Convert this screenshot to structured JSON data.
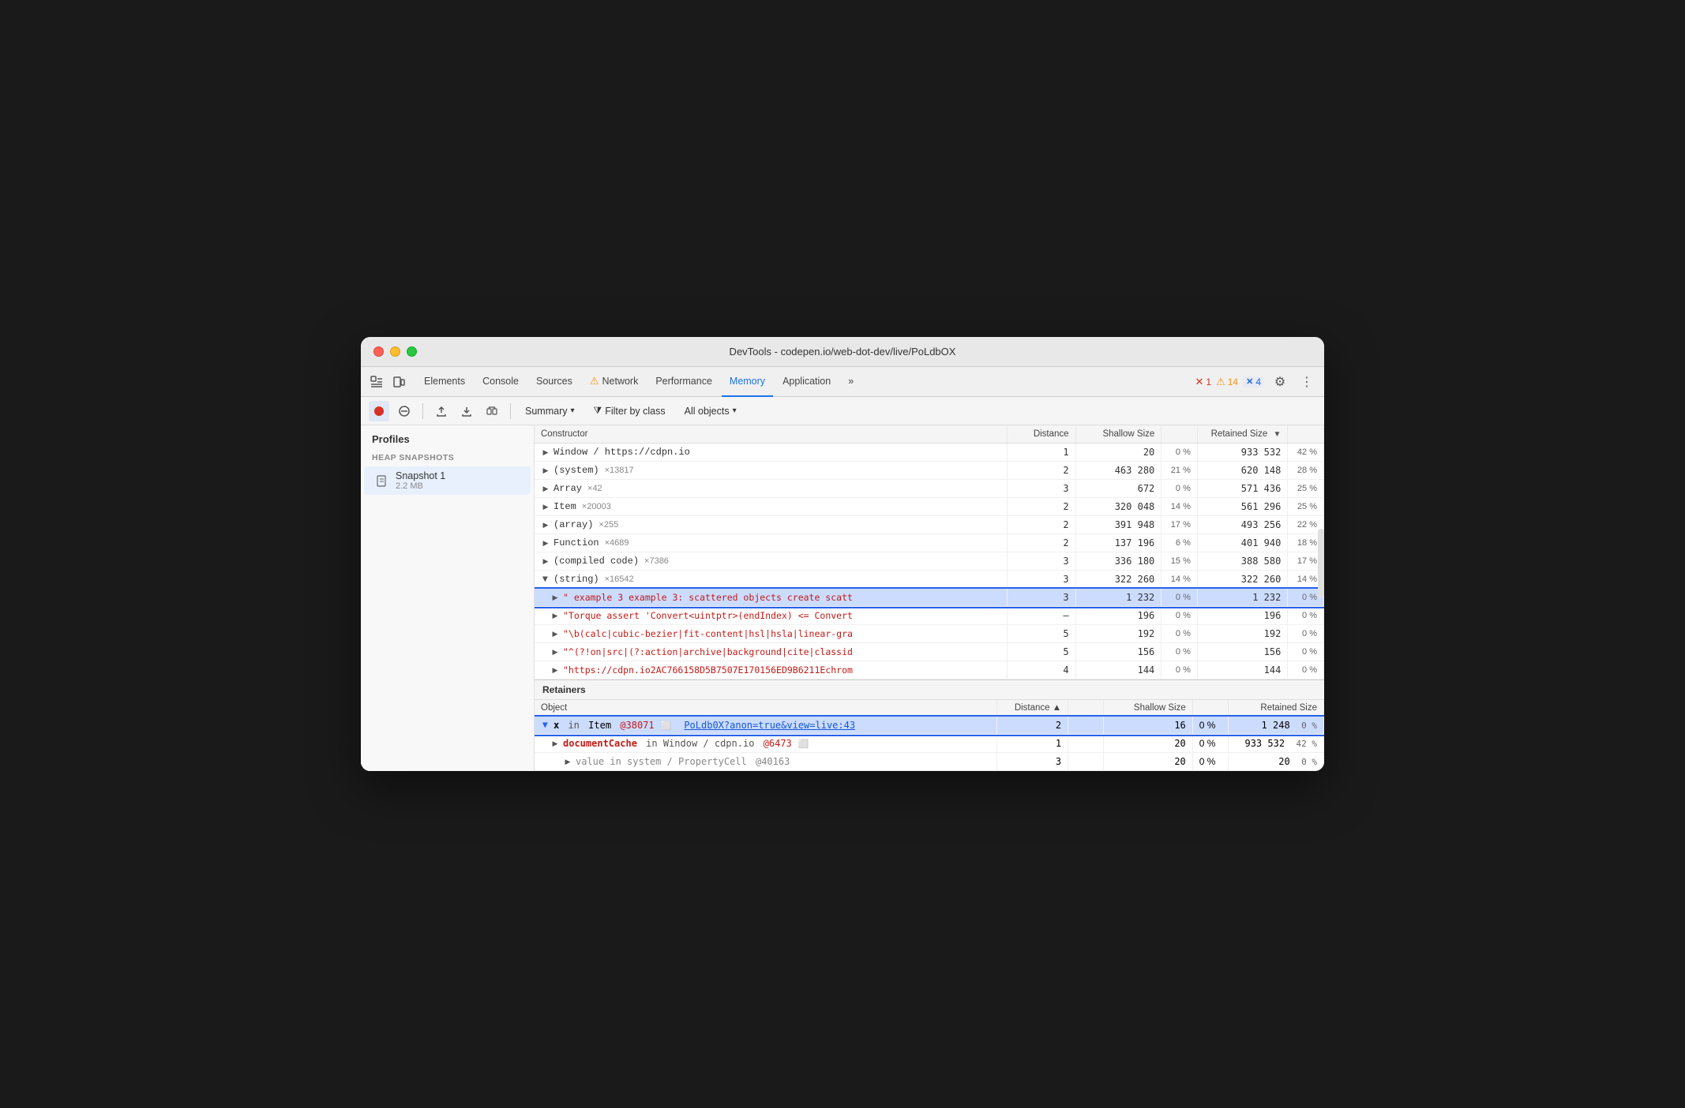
{
  "window": {
    "title": "DevTools - codepen.io/web-dot-dev/live/PoLdbOX"
  },
  "tabs": {
    "items": [
      {
        "label": "Elements",
        "active": false
      },
      {
        "label": "Console",
        "active": false
      },
      {
        "label": "Sources",
        "active": false
      },
      {
        "label": "⚠ Network",
        "active": false
      },
      {
        "label": "Performance",
        "active": false
      },
      {
        "label": "Memory",
        "active": true
      },
      {
        "label": "Application",
        "active": false
      },
      {
        "label": "»",
        "active": false
      }
    ],
    "errors": {
      "icon": "✕",
      "count": "1"
    },
    "warnings": {
      "icon": "⚠",
      "count": "14"
    },
    "info": {
      "icon": "✕",
      "count": "4"
    }
  },
  "toolbar": {
    "summary_label": "Summary",
    "filter_label": "Filter by class",
    "objects_label": "All objects"
  },
  "sidebar": {
    "title": "Profiles",
    "section_label": "HEAP SNAPSHOTS",
    "snapshot": {
      "name": "Snapshot 1",
      "size": "2.2 MB"
    }
  },
  "table": {
    "columns": [
      "Constructor",
      "Distance",
      "Shallow Size",
      "",
      "Retained Size",
      ""
    ],
    "rows": [
      {
        "constructor": "Window / https://cdpn.io",
        "indent": 0,
        "expandable": true,
        "distance": "1",
        "shallow": "20",
        "shallow_pct": "0 %",
        "retained": "933 532",
        "retained_pct": "42 %"
      },
      {
        "constructor": "(system)",
        "count": "×13817",
        "indent": 0,
        "expandable": true,
        "distance": "2",
        "shallow": "463 280",
        "shallow_pct": "21 %",
        "retained": "620 148",
        "retained_pct": "28 %"
      },
      {
        "constructor": "Array",
        "count": "×42",
        "indent": 0,
        "expandable": true,
        "distance": "3",
        "shallow": "672",
        "shallow_pct": "0 %",
        "retained": "571 436",
        "retained_pct": "25 %"
      },
      {
        "constructor": "Item",
        "count": "×20003",
        "indent": 0,
        "expandable": true,
        "distance": "2",
        "shallow": "320 048",
        "shallow_pct": "14 %",
        "retained": "561 296",
        "retained_pct": "25 %"
      },
      {
        "constructor": "(array)",
        "count": "×255",
        "indent": 0,
        "expandable": true,
        "distance": "2",
        "shallow": "391 948",
        "shallow_pct": "17 %",
        "retained": "493 256",
        "retained_pct": "22 %"
      },
      {
        "constructor": "Function",
        "count": "×4689",
        "indent": 0,
        "expandable": true,
        "distance": "2",
        "shallow": "137 196",
        "shallow_pct": "6 %",
        "retained": "401 940",
        "retained_pct": "18 %"
      },
      {
        "constructor": "(compiled code)",
        "count": "×7386",
        "indent": 0,
        "expandable": true,
        "distance": "3",
        "shallow": "336 180",
        "shallow_pct": "15 %",
        "retained": "388 580",
        "retained_pct": "17 %"
      },
      {
        "constructor": "(string)",
        "count": "×16542",
        "indent": 0,
        "expandable": true,
        "open": true,
        "distance": "3",
        "shallow": "322 260",
        "shallow_pct": "14 %",
        "retained": "322 260",
        "retained_pct": "14 %"
      },
      {
        "constructor": "\" example 3 example 3: scattered objects create scatt",
        "indent": 1,
        "expandable": true,
        "is_string": true,
        "selected": true,
        "distance": "3",
        "shallow": "1 232",
        "shallow_pct": "0 %",
        "retained": "1 232",
        "retained_pct": "0 %"
      },
      {
        "constructor": "\"Torque assert 'Convert<uintptr>(endIndex) <= Convert",
        "indent": 1,
        "expandable": true,
        "is_string": true,
        "is_red": true,
        "distance": "–",
        "shallow": "196",
        "shallow_pct": "0 %",
        "retained": "196",
        "retained_pct": "0 %"
      },
      {
        "constructor": "\"\\b(calc|cubic-bezier|fit-content|hsl|hsla|linear-gra",
        "indent": 1,
        "expandable": true,
        "is_string": true,
        "is_red": true,
        "distance": "5",
        "shallow": "192",
        "shallow_pct": "0 %",
        "retained": "192",
        "retained_pct": "0 %"
      },
      {
        "constructor": "\"^(?!on|src|(?:action|archive|background|cite|classid",
        "indent": 1,
        "expandable": true,
        "is_string": true,
        "is_red": true,
        "distance": "5",
        "shallow": "156",
        "shallow_pct": "0 %",
        "retained": "156",
        "retained_pct": "0 %"
      },
      {
        "constructor": "\"https://cdpn.io2AC766158D5B7507E170156ED9B6211Echrom",
        "indent": 1,
        "expandable": true,
        "is_string": true,
        "is_red": true,
        "distance": "4",
        "shallow": "144",
        "shallow_pct": "0 %",
        "retained": "144",
        "retained_pct": "0 %"
      }
    ]
  },
  "retainers": {
    "title": "Retainers",
    "columns": [
      "Object",
      "Distance",
      "",
      "Shallow Size",
      "",
      "Retained Size"
    ],
    "rows": [
      {
        "object": "x in Item @38071",
        "has_window_icon": true,
        "link": "PoLdb0X?anon=true&view=live:43",
        "selected": true,
        "distance": "2",
        "shallow": "16",
        "shallow_pct": "0 %",
        "retained": "1 248",
        "retained_pct": "0 %"
      },
      {
        "object": "documentCache in Window / cdpn.io @6473",
        "has_window_icon": true,
        "indent": 1,
        "expandable": true,
        "distance": "1",
        "shallow": "20",
        "shallow_pct": "0 %",
        "retained": "933 532",
        "retained_pct": "42 %"
      },
      {
        "object": "value in system / PropertyCell @40163",
        "indent": 2,
        "expandable": true,
        "distance": "3",
        "shallow": "20",
        "shallow_pct": "0 %",
        "retained": "20",
        "retained_pct": "0 %"
      }
    ]
  }
}
